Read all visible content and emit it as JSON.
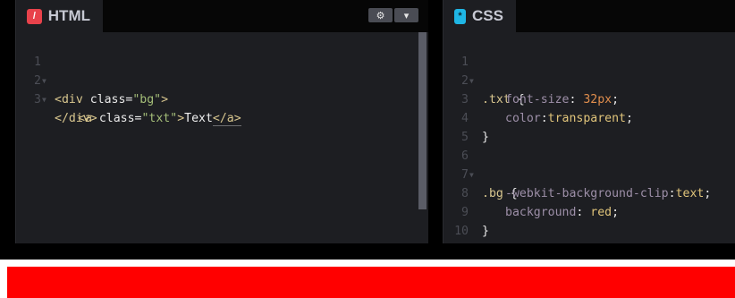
{
  "html_panel": {
    "tab_label": "HTML",
    "tab_icon": "/",
    "settings_icon": "⚙",
    "collapse_icon": "▾",
    "lines": [
      {
        "num": "1",
        "foldable": true
      },
      {
        "num": "2",
        "foldable": true
      },
      {
        "num": "3",
        "foldable": false
      }
    ],
    "code": {
      "l1_open": "<div ",
      "l1_attr": "class",
      "l1_eq": "=",
      "l1_str": "\"bg\"",
      "l1_close": ">",
      "l2_open": "<a ",
      "l2_attr": "class",
      "l2_eq": "=",
      "l2_str": "\"txt\"",
      "l2_gt": ">",
      "l2_text": "Text",
      "l2_end": "</a>",
      "l3": "</div>"
    }
  },
  "css_panel": {
    "tab_label": "CSS",
    "tab_icon": "*",
    "lines": [
      {
        "num": "1",
        "foldable": true
      },
      {
        "num": "2",
        "foldable": false
      },
      {
        "num": "3",
        "foldable": false
      },
      {
        "num": "4",
        "foldable": false
      },
      {
        "num": "5",
        "foldable": false
      },
      {
        "num": "6",
        "foldable": true
      },
      {
        "num": "7",
        "foldable": false
      },
      {
        "num": "8",
        "foldable": false
      },
      {
        "num": "9",
        "foldable": false
      },
      {
        "num": "10",
        "foldable": false
      }
    ],
    "code": {
      "l1_sel": ".txt",
      "l1_brace": " {",
      "l2_prop": "font-size",
      "l2_colon": ": ",
      "l2_val": "32px",
      "l2_semi": ";",
      "l3_prop": "color",
      "l3_colon": ":",
      "l3_val": "transparent",
      "l3_semi": ";",
      "l4": "}",
      "l6_sel": ".bg",
      "l6_brace": " {",
      "l7_prop": "-webkit-background-clip",
      "l7_colon": ":",
      "l7_val": "text",
      "l7_semi": ";",
      "l8_prop": "background",
      "l8_colon": ": ",
      "l8_val": "red",
      "l8_semi": ";",
      "l9": "}"
    }
  },
  "colors": {
    "html_icon_bg": "#e8424b",
    "css_icon_bg": "#1fb6e5",
    "result_fill": "#ff0000"
  }
}
